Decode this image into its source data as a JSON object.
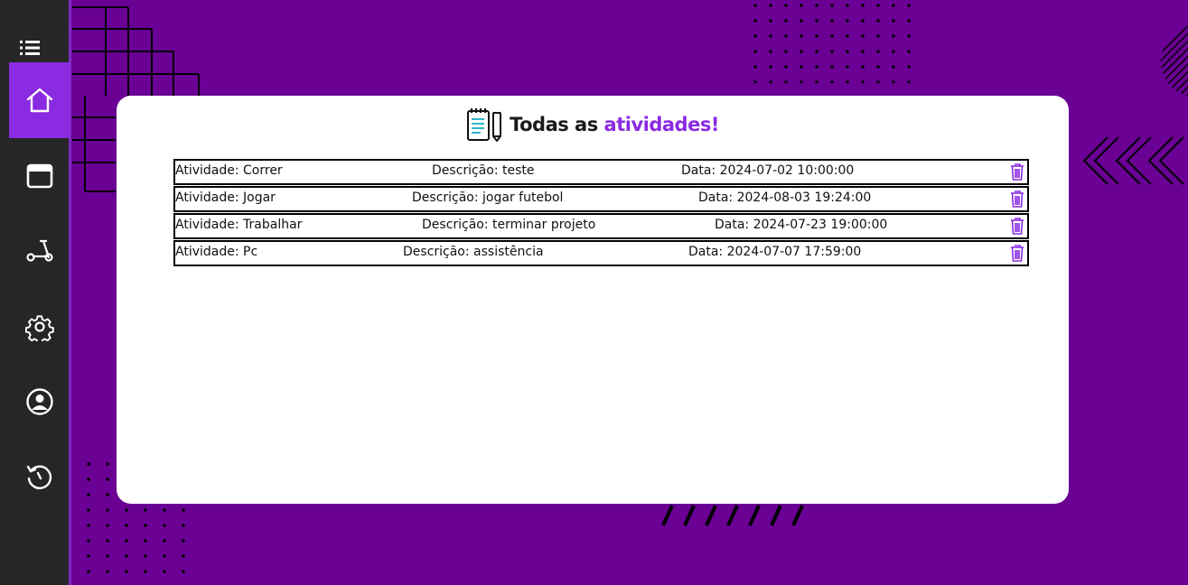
{
  "header": {
    "title_main": "Todas as",
    "title_accent": "atividades!"
  },
  "sidebar": {
    "items": [
      {
        "icon": "menu-icon"
      },
      {
        "icon": "home-icon",
        "active": true
      },
      {
        "icon": "calendar-icon"
      },
      {
        "icon": "scooter-icon"
      },
      {
        "icon": "gear-icon"
      },
      {
        "icon": "user-icon"
      },
      {
        "icon": "history-icon"
      }
    ]
  },
  "activities": [
    {
      "name": "Atividade: Correr",
      "description": "Descrição: teste",
      "date": "Data: 2024-07-02 10:00:00"
    },
    {
      "name": "Atividade: Jogar",
      "description": "Descrição: jogar futebol",
      "date": "Data: 2024-08-03 19:24:00"
    },
    {
      "name": "Atividade: Trabalhar",
      "description": "Descrição: terminar projeto",
      "date": "Data: 2024-07-23 19:00:00"
    },
    {
      "name": "Atividade: Pc",
      "description": "Descrição: assistência",
      "date": "Data: 2024-07-07 17:59:00"
    }
  ],
  "colors": {
    "background": "#6a0094",
    "sidebar": "#262626",
    "accent": "#8a2be2",
    "card": "#ffffff"
  }
}
